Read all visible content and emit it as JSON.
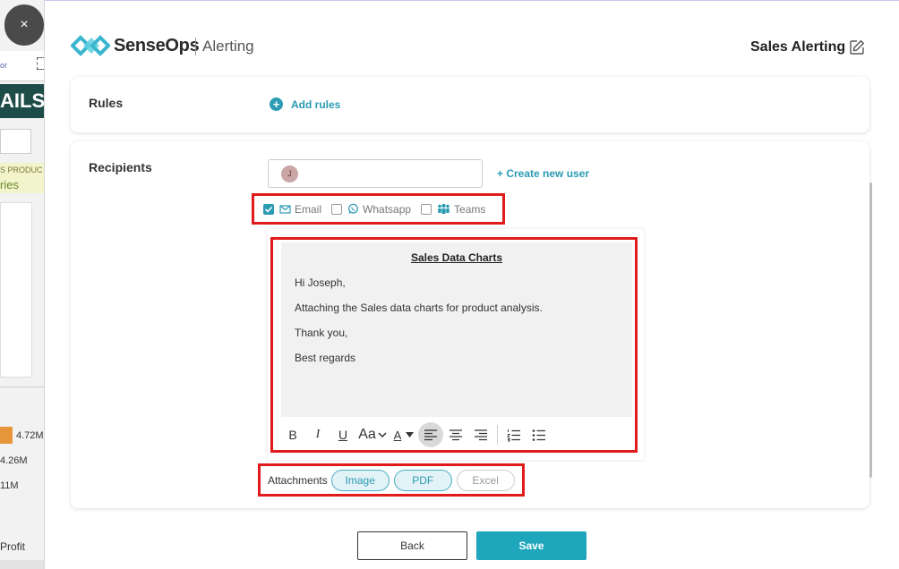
{
  "background": {
    "tab_text": "or",
    "banner_text": "AILS",
    "yellow_line1": "S PRODUC",
    "yellow_line2": "ries",
    "values": [
      "4.72M",
      "4.26M",
      "11M"
    ],
    "profit_label": "Profit"
  },
  "modal": {
    "close_glyph": "×",
    "brand": "SenseOps",
    "brand_sub": "Alerting",
    "title": "Sales Alerting",
    "accent_color": "#2a9bb3"
  },
  "rules": {
    "label": "Rules",
    "add_label": "Add rules"
  },
  "recipients": {
    "label": "Recipients",
    "avatar_initial": "J",
    "create_user": "+ Create new user",
    "channels": [
      {
        "label": "Email",
        "checked": true,
        "icon": "envelope-icon"
      },
      {
        "label": "Whatsapp",
        "checked": false,
        "icon": "whatsapp-icon"
      },
      {
        "label": "Teams",
        "checked": false,
        "icon": "teams-icon"
      }
    ]
  },
  "editor": {
    "title": "Sales Data Charts",
    "lines": [
      "Hi Joseph,",
      "Attaching the Sales data charts for product analysis.",
      "Thank you,",
      "Best regards"
    ],
    "toolbar": {
      "bold": "B",
      "italic": "I",
      "underline": "U",
      "font_size": "Aa",
      "font_color": "A"
    }
  },
  "attachments": {
    "label": "Attachments",
    "options": [
      {
        "label": "Image",
        "selected": true
      },
      {
        "label": "PDF",
        "selected": true
      },
      {
        "label": "Excel",
        "selected": false
      }
    ]
  },
  "footer": {
    "back_label": "Back",
    "save_label": "Save"
  }
}
